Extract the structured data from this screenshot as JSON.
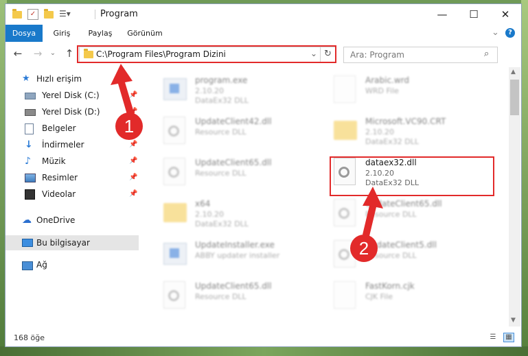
{
  "window": {
    "title": "Program",
    "minimize_glyph": "—",
    "maximize_glyph": "☐",
    "close_glyph": "✕"
  },
  "ribbon": {
    "tabs": [
      {
        "label": "Dosya",
        "active": true
      },
      {
        "label": "Giriş",
        "active": false
      },
      {
        "label": "Paylaş",
        "active": false
      },
      {
        "label": "Görünüm",
        "active": false
      }
    ],
    "expand_glyph": "⌄",
    "help_glyph": "?"
  },
  "address": {
    "path": "C:\\Program Files\\Program Dizini",
    "search_placeholder": "Ara: Program"
  },
  "nav": {
    "quick_access": "Hızlı erişim",
    "items": [
      {
        "label": "Yerel Disk (C:)",
        "icon": "disk-icon"
      },
      {
        "label": "Yerel Disk (D:)",
        "icon": "disk-icon"
      },
      {
        "label": "Belgeler",
        "icon": "documents-icon"
      },
      {
        "label": "İndirmeler",
        "icon": "download-icon"
      },
      {
        "label": "Müzik",
        "icon": "music-icon"
      },
      {
        "label": "Resimler",
        "icon": "pictures-icon"
      },
      {
        "label": "Videolar",
        "icon": "videos-icon"
      }
    ],
    "onedrive": "OneDrive",
    "this_pc": "Bu bilgisayar",
    "network": "Ağ"
  },
  "files": [
    {
      "name": "program.exe",
      "l2": "2.10.20",
      "l3": "DataEx32 DLL"
    },
    {
      "name": "Arabic.wrd",
      "l2": "WRD File",
      "l3": ""
    },
    {
      "name": "UpdateClient42.dll",
      "l2": "Resource DLL",
      "l3": ""
    },
    {
      "name": "Microsoft.VC90.CRT",
      "l2": "2.10.20",
      "l3": "DataEx32 DLL"
    },
    {
      "name": "UpdateClient65.dll",
      "l2": "Resource DLL",
      "l3": ""
    },
    {
      "name": "dataex32.dll",
      "l2": "2.10.20",
      "l3": "DataEx32 DLL"
    },
    {
      "name": "x64",
      "l2": "2.10.20",
      "l3": "DataEx32 DLL"
    },
    {
      "name": "UpdateClient65.dll",
      "l2": "Resource DLL",
      "l3": ""
    },
    {
      "name": "UpdateInstaller.exe",
      "l2": "ABBY updater installer",
      "l3": ""
    },
    {
      "name": "UpdateClient5.dll",
      "l2": "Resource DLL",
      "l3": ""
    },
    {
      "name": "UpdateClient65.dll",
      "l2": "Resource DLL",
      "l3": ""
    },
    {
      "name": "FastKorn.cjk",
      "l2": "CJK File",
      "l3": ""
    }
  ],
  "status": {
    "count": "168 öğe"
  },
  "callouts": {
    "one": "1",
    "two": "2"
  },
  "colors": {
    "accent": "#1979ca",
    "highlight": "#e22a2a"
  }
}
